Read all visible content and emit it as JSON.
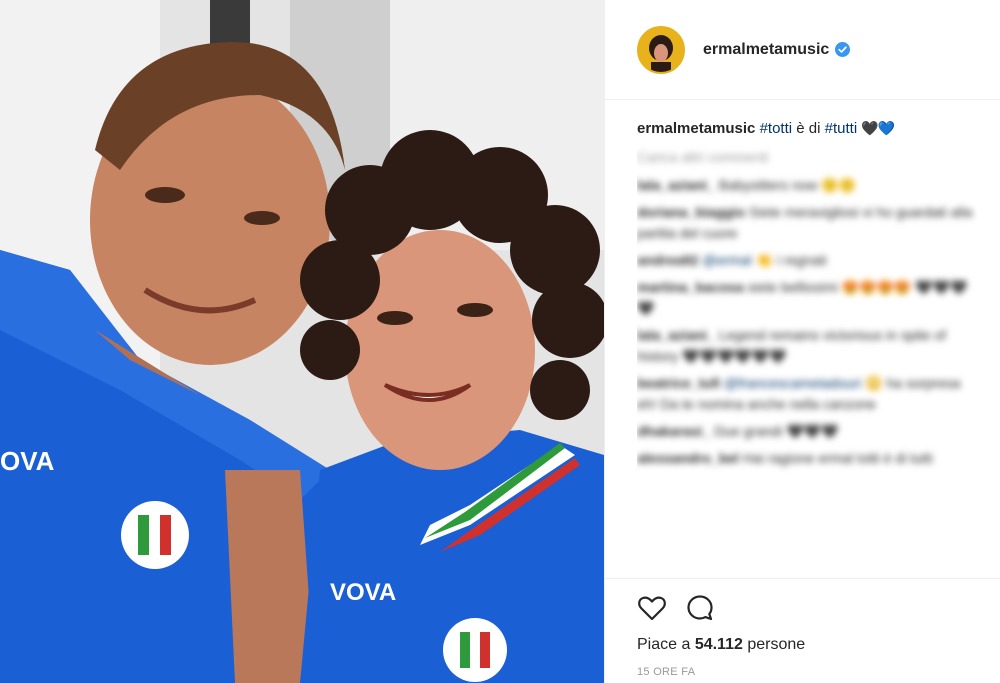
{
  "post": {
    "account": {
      "username": "ermalmetamusic",
      "verified": true,
      "avatar_description": "avatar"
    },
    "caption": {
      "username": "ermalmetamusic",
      "parts": [
        {
          "type": "tag",
          "text": "#totti"
        },
        {
          "type": "text",
          "text": " è di "
        },
        {
          "type": "tag",
          "text": "#tutti"
        },
        {
          "type": "text",
          "text": " "
        },
        {
          "type": "emoji",
          "text": "🖤💙"
        }
      ]
    },
    "load_more_label": "Carica altri commenti",
    "comments": [
      {
        "username": "lala_aziani_",
        "text": "Babysitters now 🙂🙂"
      },
      {
        "username": "doriana_biaggio",
        "text": "Siete meravigliosi vi ho guardati alla partita del cuore"
      },
      {
        "username": "andrea92",
        "text": "",
        "mention": "@ermal",
        "after": " 👏 i regnati"
      },
      {
        "username": "martina_bacosa",
        "text": "siete bellissimi 😍😍😍😍 🖤🖤🖤🖤"
      },
      {
        "username": "lala_aziani_",
        "text": "Legend remains victorious in spite of history 🖤🖤🖤🖤🖤🖤"
      },
      {
        "username": "beatrice_tufi",
        "text": "",
        "mention": "@francescametadouri",
        "after": " 😳 ha sorpresa eh! Da te nomina anche nella canzone"
      },
      {
        "username": "dhakarasi_",
        "text": "Due grandi 🖤🖤🖤"
      },
      {
        "username": "alessandro_bel",
        "text": "Hai ragione ermal totti è di tutti"
      }
    ],
    "likes_prefix": "Piace a ",
    "likes_count": "54.112",
    "likes_suffix": " persone",
    "timestamp": "15 ORE FA",
    "colors": {
      "verified_badge": "#3897f0",
      "jersey_blue": "#1b5fd4",
      "avatar_bg": "#e8b21c",
      "tag_link": "#003569"
    },
    "icons": [
      "heart-icon",
      "comment-icon",
      "verified-badge-icon"
    ]
  }
}
